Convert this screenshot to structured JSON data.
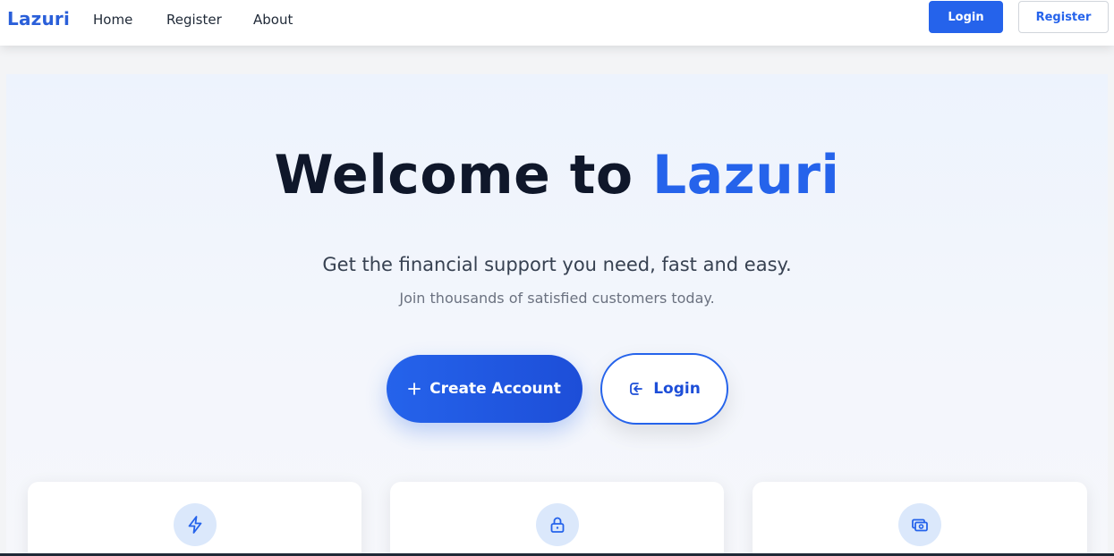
{
  "nav": {
    "brand": "Lazuri",
    "links": [
      "Home",
      "Register",
      "About"
    ],
    "login_label": "Login",
    "register_label": "Register"
  },
  "hero": {
    "title_prefix": "Welcome to",
    "title_accent": "Lazuri",
    "subtitle": "Get the financial support you need, fast and easy.",
    "subtitle2": "Join thousands of satisfied customers today.",
    "create_label": "Create Account",
    "login_label": "Login"
  },
  "features": [
    {
      "icon": "lightning-icon"
    },
    {
      "icon": "lock-icon"
    },
    {
      "icon": "money-icon"
    }
  ],
  "colors": {
    "accent": "#2563eb",
    "title": "#0f172a",
    "icon_bg": "#dbe8fb"
  }
}
